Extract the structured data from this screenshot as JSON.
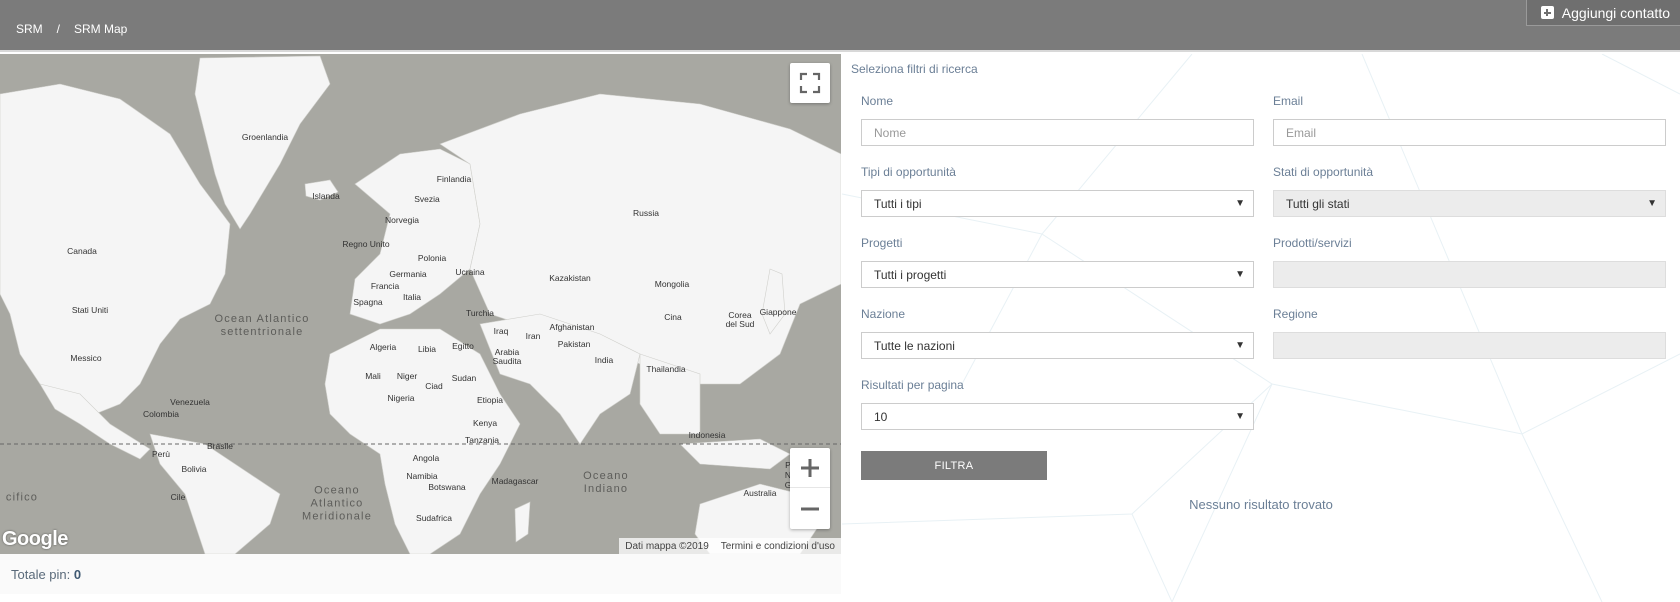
{
  "breadcrumb": {
    "root": "SRM",
    "separator": "/",
    "current": "SRM Map"
  },
  "header": {
    "add_contact_label": "Aggiungi contatto"
  },
  "map": {
    "countries": [
      {
        "name": "Groenlandia"
      },
      {
        "name": "Islanda"
      },
      {
        "name": "Finlandia"
      },
      {
        "name": "Svezia"
      },
      {
        "name": "Norvegia"
      },
      {
        "name": "Russia"
      },
      {
        "name": "Regno Unito"
      },
      {
        "name": "Polonia"
      },
      {
        "name": "Germania"
      },
      {
        "name": "Ucraina"
      },
      {
        "name": "Kazakistan"
      },
      {
        "name": "Mongolia"
      },
      {
        "name": "Francia"
      },
      {
        "name": "Italia"
      },
      {
        "name": "Spagna"
      },
      {
        "name": "Canada"
      },
      {
        "name": "Stati Uniti"
      },
      {
        "name": "Turchia"
      },
      {
        "name": "Cina"
      },
      {
        "name": "Giappone"
      },
      {
        "name": "Corea del Sud"
      },
      {
        "name": "Afghanistan"
      },
      {
        "name": "Iraq"
      },
      {
        "name": "Iran"
      },
      {
        "name": "Pakistan"
      },
      {
        "name": "Algeria"
      },
      {
        "name": "Libia"
      },
      {
        "name": "Egitto"
      },
      {
        "name": "Arabia Saudita"
      },
      {
        "name": "India"
      },
      {
        "name": "Thailandia"
      },
      {
        "name": "Messico"
      },
      {
        "name": "Mali"
      },
      {
        "name": "Niger"
      },
      {
        "name": "Ciad"
      },
      {
        "name": "Sudan"
      },
      {
        "name": "Nigeria"
      },
      {
        "name": "Etiopia"
      },
      {
        "name": "Venezuela"
      },
      {
        "name": "Colombia"
      },
      {
        "name": "Kenya"
      },
      {
        "name": "Indonesia"
      },
      {
        "name": "Tanzania"
      },
      {
        "name": "Perù"
      },
      {
        "name": "Brasile"
      },
      {
        "name": "Angola"
      },
      {
        "name": "Bolivia"
      },
      {
        "name": "Namibia"
      },
      {
        "name": "Madagascar"
      },
      {
        "name": "Botswana"
      },
      {
        "name": "Cile"
      },
      {
        "name": "Australia"
      },
      {
        "name": "Sudafrica"
      }
    ],
    "oceans": [
      "Ocean Atlantico settentrionale",
      "Oceano Atlantico Meridionale",
      "Oceano Indiano",
      "cifico"
    ],
    "partial_label": "P N G",
    "google_label": "Google",
    "credits_data": "Dati mappa ©2019",
    "credits_terms": "Termini e condizioni d'uso",
    "total_pins_label": "Totale pin:",
    "total_pins_value": "0"
  },
  "filters": {
    "title": "Seleziona filtri di ricerca",
    "nome": {
      "label": "Nome",
      "placeholder": "Nome"
    },
    "email": {
      "label": "Email",
      "placeholder": "Email"
    },
    "tipi": {
      "label": "Tipi di opportunità",
      "value": "Tutti i tipi"
    },
    "stati": {
      "label": "Stati di opportunità",
      "value": "Tutti gli stati"
    },
    "progetti": {
      "label": "Progetti",
      "value": "Tutti i progetti"
    },
    "prodotti": {
      "label": "Prodotti/servizi",
      "value": ""
    },
    "nazione": {
      "label": "Nazione",
      "value": "Tutte le nazioni"
    },
    "regione": {
      "label": "Regione",
      "value": ""
    },
    "risultati": {
      "label": "Risultati per pagina",
      "value": "10"
    },
    "button_label": "FILTRA",
    "no_results": "Nessuno risultato trovato"
  }
}
